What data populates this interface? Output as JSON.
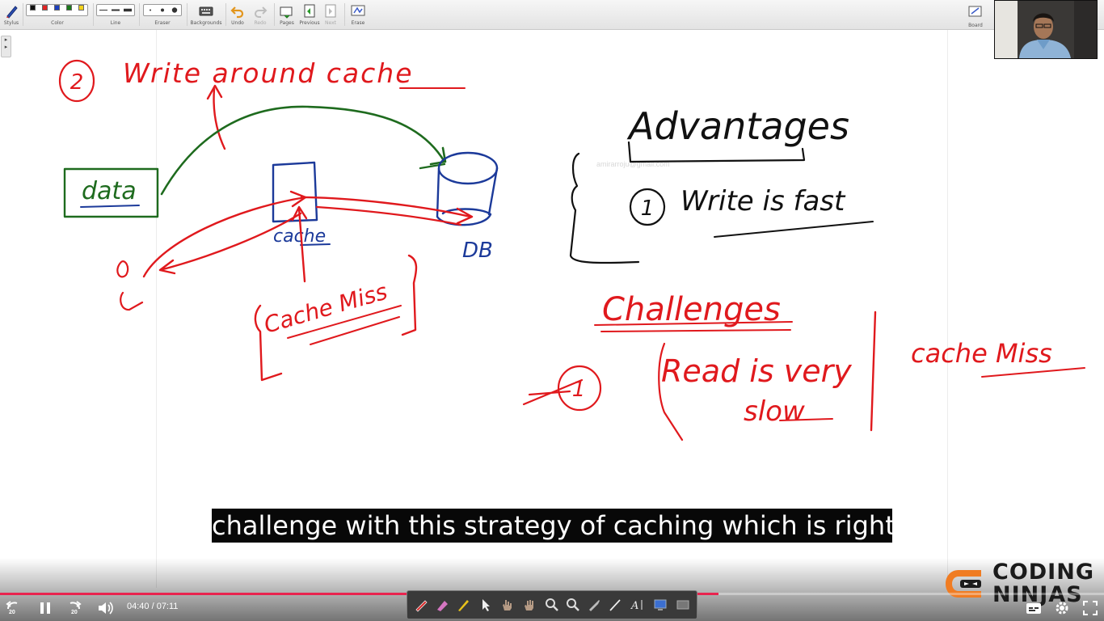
{
  "toolbar": {
    "groups": [
      {
        "label": "Stylus"
      },
      {
        "label": "Color"
      },
      {
        "label": "Line"
      },
      {
        "label": "Eraser"
      },
      {
        "label": "Backgrounds"
      },
      {
        "label": "Undo"
      },
      {
        "label": "Redo"
      },
      {
        "label": "Pages"
      },
      {
        "label": "Previous"
      },
      {
        "label": "Next"
      },
      {
        "label": "Erase"
      },
      {
        "label": "Board"
      }
    ],
    "colors": [
      "#111111",
      "#e32424",
      "#1c3fbf",
      "#1a7a1a",
      "#f3d21a"
    ]
  },
  "whiteboard": {
    "watermark_email": "amirarroju@gmail.com",
    "notes": {
      "heading_number": "2",
      "heading": "Write around cache",
      "data_box": "data",
      "cache_label": "cache",
      "db_label": "DB",
      "cache_miss": "Cache Miss",
      "advantages_title": "Advantages",
      "advantage_1_number": "1",
      "advantage_1": "Write is fast",
      "challenges_title": "Challenges",
      "challenge_1_number": "1",
      "challenge_1_line1": "Read is very",
      "challenge_1_line2": "slow",
      "challenge_side_note": "cache Miss"
    },
    "colors": {
      "red_ink": "#e0191d",
      "green_ink": "#1e6b1e",
      "blue_ink": "#1c3a9a",
      "black_ink": "#111111"
    }
  },
  "subtitle": "challenge with this strategy of caching which is right",
  "player": {
    "current_time": "04:40",
    "duration": "07:11",
    "time_display": "04:40 / 07:11",
    "progress": 0.651,
    "rewind_seconds": "20",
    "forward_seconds": "20",
    "accent": "#e9234e"
  },
  "brand": {
    "line1": "CODING",
    "line2": "NINJAS",
    "accent": "#f07c22"
  }
}
